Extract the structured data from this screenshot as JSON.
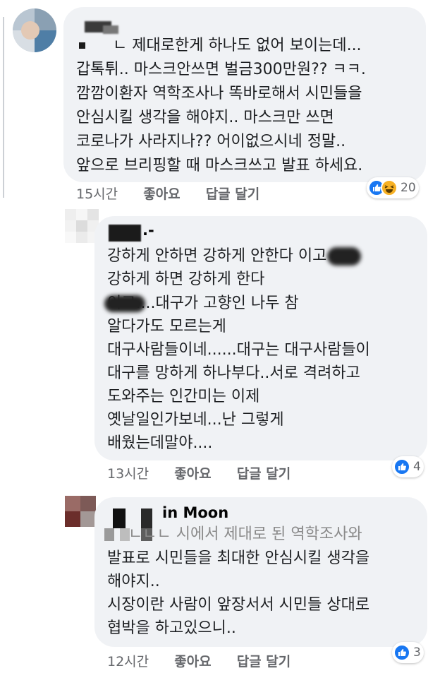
{
  "comments": [
    {
      "author": "",
      "lines": [
        "ㄴ 제대로한게 하나도 없어 보이는데...",
        "갑톡튀.. 마스크안쓰면 벌금300만원?? ㅋㅋ.",
        "깜깜이환자 역학조사나 똑바로해서 시민들을",
        "안심시킬 생각을 해야지.. 마스크만 쓰면",
        "코로나가 사라지나?? 어이없으시네 정말..",
        "앞으로 브리핑할 때 마스크쓰고 발표 하세요."
      ],
      "time": "15시간",
      "like_label": "좋아요",
      "reply_label": "답글 달기",
      "reaction_icons": [
        "like-icon",
        "haha-icon"
      ],
      "reaction_count": "20"
    },
    {
      "author": ".-",
      "lines": [
        "강하게 안하면 강하게 안한다        이고",
        "강하게 하면 강하게 한다",
        "        이고....대구가 고향인 나두 참",
        "알다가도 모르는게",
        "대구사람들이네......대구는 대구사람들이",
        "대구를 망하게 하나부다..서로 격려하고",
        "도와주는 인간미는 이제",
        "옛날일인가보네...난 그렇게",
        "배웠는데말야...."
      ],
      "time": "13시간",
      "like_label": "좋아요",
      "reply_label": "답글 달기",
      "reaction_icons": [
        "like-icon"
      ],
      "reaction_count": "4"
    },
    {
      "author": "in Moon",
      "lines": [
        "ㄴㄴㄴ 시에서 제대로 된 역학조사와",
        "발표로 시민들을 최대한 안심시킬 생각을",
        "해야지..",
        "시장이란 사람이 앞장서서 시민들 상대로",
        "협박을 하고있으니.."
      ],
      "time": "12시간",
      "like_label": "좋아요",
      "reply_label": "답글 달기",
      "reaction_icons": [
        "like-icon"
      ],
      "reaction_count": "3"
    }
  ],
  "colors": {
    "bubble": "#f0f2f5",
    "meta_text": "#65676b",
    "like_blue": "#1877f2",
    "haha_yellow": "#f7b125"
  }
}
